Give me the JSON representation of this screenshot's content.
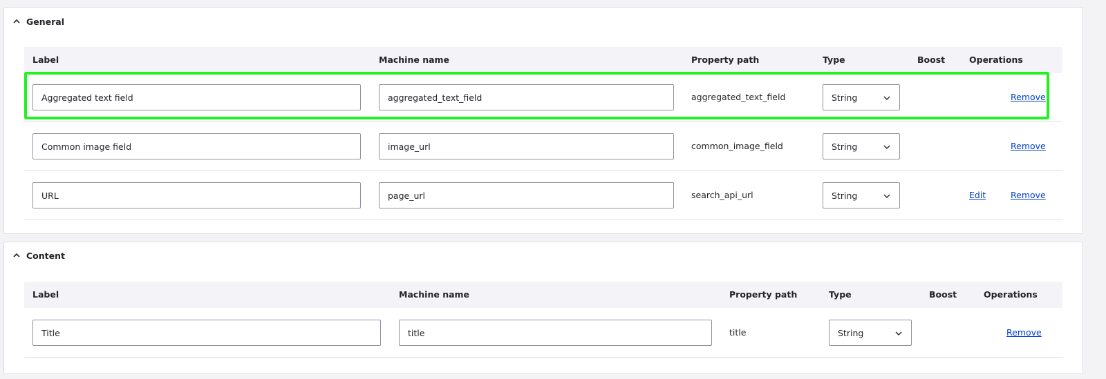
{
  "general": {
    "title": "General",
    "columns": {
      "label": "Label",
      "machine_name": "Machine name",
      "property_path": "Property path",
      "type": "Type",
      "boost": "Boost",
      "operations": "Operations"
    },
    "rows": [
      {
        "label": "Aggregated text field",
        "machine_name": "aggregated_text_field",
        "property_path": "aggregated_text_field",
        "type": "String",
        "edit": "",
        "remove": "Remove"
      },
      {
        "label": "Common image field",
        "machine_name": "image_url",
        "property_path": "common_image_field",
        "type": "String",
        "edit": "",
        "remove": "Remove"
      },
      {
        "label": "URL",
        "machine_name": "page_url",
        "property_path": "search_api_url",
        "type": "String",
        "edit": "Edit",
        "remove": "Remove"
      }
    ]
  },
  "content": {
    "title": "Content",
    "columns": {
      "label": "Label",
      "machine_name": "Machine name",
      "property_path": "Property path",
      "type": "Type",
      "boost": "Boost",
      "operations": "Operations"
    },
    "rows": [
      {
        "label": "Title",
        "machine_name": "title",
        "property_path": "title",
        "type": "String",
        "edit": "",
        "remove": "Remove"
      }
    ]
  },
  "colors": {
    "highlight": "#21f21f",
    "link": "#003ecc"
  },
  "icons": {
    "collapse": "chevron-up-icon",
    "select": "chevron-down-icon"
  }
}
